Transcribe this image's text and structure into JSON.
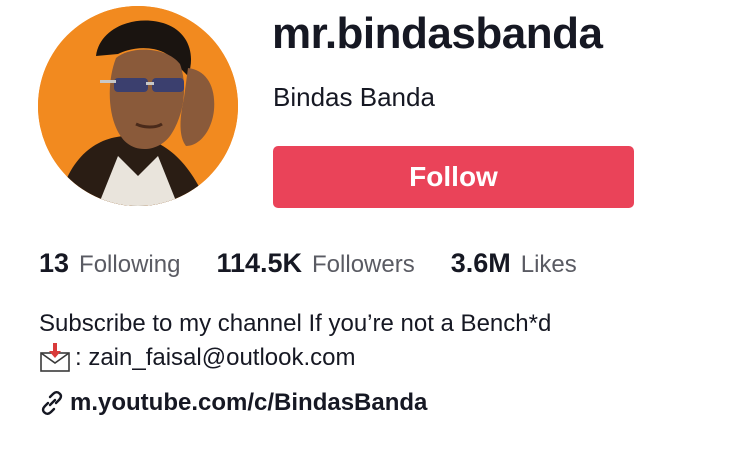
{
  "profile": {
    "username": "mr.bindasbanda",
    "display_name": "Bindas Banda",
    "follow_label": "Follow"
  },
  "stats": {
    "following": {
      "count": "13",
      "label": "Following"
    },
    "followers": {
      "count": "114.5K",
      "label": "Followers"
    },
    "likes": {
      "count": "3.6M",
      "label": "Likes"
    }
  },
  "bio": {
    "line1": "Subscribe to my channel If you’re not a Bench*d",
    "line2": ": zain_faisal@outlook.com",
    "link": "m.youtube.com/c/BindasBanda"
  },
  "colors": {
    "follow_button": "#ea4359",
    "avatar_background": "#f28a1f",
    "text_primary": "#161823",
    "text_secondary": "#5a5b63"
  },
  "icons": {
    "mail": "envelope-with-arrow-icon",
    "link": "chain-link-icon"
  }
}
